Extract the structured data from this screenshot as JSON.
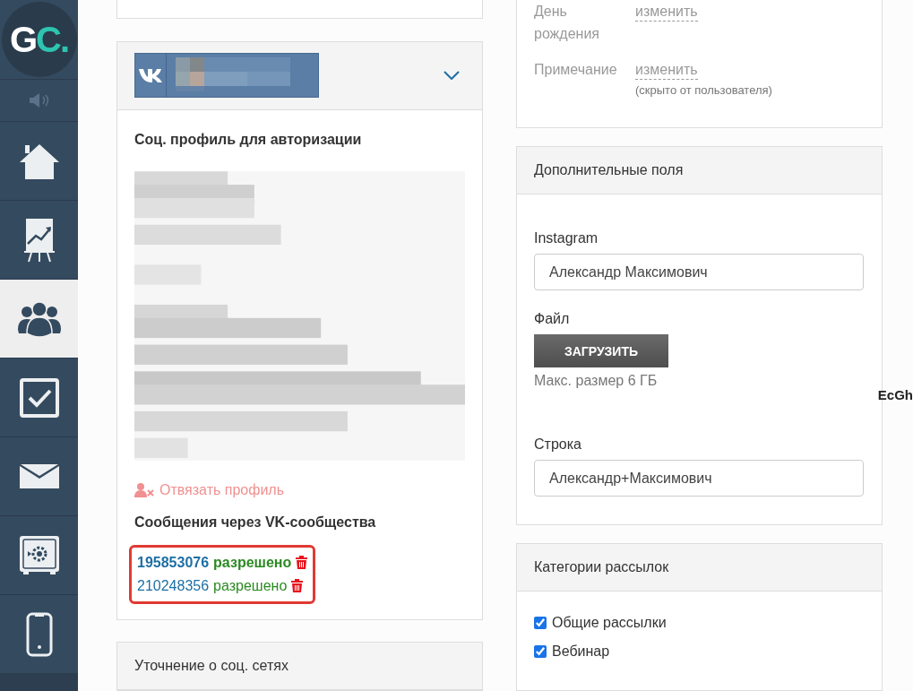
{
  "sidebar": {
    "logo": {
      "first": "G",
      "second": "C."
    },
    "nav_items": [
      {
        "kind": "sound",
        "selected": false
      },
      {
        "kind": "home",
        "selected": false
      },
      {
        "kind": "chart",
        "selected": false
      },
      {
        "kind": "users",
        "selected": true
      },
      {
        "kind": "tasks",
        "selected": false
      },
      {
        "kind": "mail",
        "selected": false
      },
      {
        "kind": "safe",
        "selected": false
      },
      {
        "kind": "phone",
        "selected": false
      }
    ]
  },
  "left_column": {
    "social_card": {
      "expanded": false,
      "auth_title": "Соц. профиль для авторизации",
      "unlink": "Отвязать профиль",
      "messages_title": "Сообщения через VK-сообщества",
      "highlighted": true,
      "communities": [
        {
          "id": "195853076",
          "status": "разрешено",
          "bold": true
        },
        {
          "id": "210248356",
          "status": "разрешено",
          "bold": false
        }
      ]
    },
    "social_note_card": {
      "title": "Уточнение о соц. сетях"
    }
  },
  "right_column": {
    "profile_rows": [
      {
        "label": "День рождения",
        "action": "изменить"
      },
      {
        "label": "Примечание",
        "action": "изменить",
        "note": "(скрыто от пользователя)"
      }
    ],
    "extra_fields": {
      "title": "Дополнительные поля",
      "fields": [
        {
          "kind": "text",
          "label": "Instagram",
          "value": "Александр Максимович"
        },
        {
          "kind": "file",
          "label": "Файл",
          "button": "ЗАГРУЗИТЬ",
          "hint": "Макс. размер 6 ГБ"
        },
        {
          "kind": "text",
          "label": "Строка",
          "value": "Александр+Максимович"
        }
      ]
    },
    "categories": {
      "title": "Категории рассылок",
      "items": [
        {
          "label": "Общие рассылки",
          "checked": true
        },
        {
          "label": "Вебинар",
          "checked": true
        }
      ]
    }
  },
  "stray_text": "EcGh"
}
